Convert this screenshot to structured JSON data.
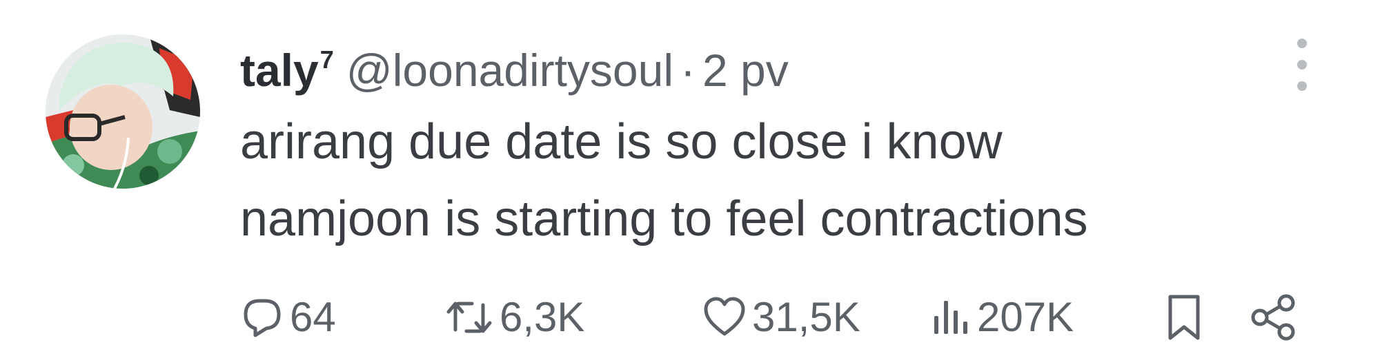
{
  "author": {
    "display_name": "taly",
    "name_superscript": "7",
    "handle": "@loonadirtysoul",
    "separator": "·",
    "time": "2 pv"
  },
  "tweet": {
    "lines": [
      "arirang due date is so close i know",
      "namjoon is starting to feel contractions"
    ]
  },
  "actions": {
    "replies": "64",
    "retweets": "6,3K",
    "likes": "31,5K",
    "views": "207K"
  },
  "colors": {
    "text": "#3a3d42",
    "muted": "#5c6167",
    "more_dots": "#b9bdc2"
  },
  "icons": {
    "reply": "reply-icon",
    "retweet": "retweet-icon",
    "like": "heart-icon",
    "views": "views-icon",
    "bookmark": "bookmark-icon",
    "share": "share-icon",
    "more": "more-icon"
  }
}
